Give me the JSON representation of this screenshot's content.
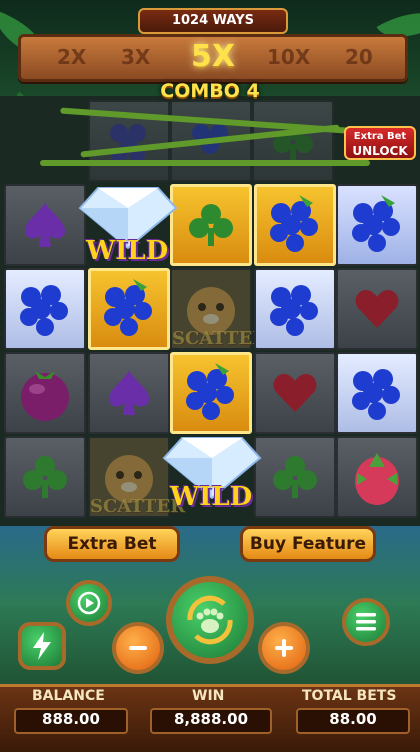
{
  "header": {
    "ways": "1024 WAYS",
    "multipliers": [
      "2X",
      "3X",
      "5X",
      "10X",
      "20"
    ],
    "active_multiplier_index": 2,
    "combo": "COMBO 4",
    "extra_bet_unlock": {
      "line1": "Extra Bet",
      "line2": "UNLOCK"
    }
  },
  "reels": {
    "grid": [
      [
        "spade",
        "club",
        "grape",
        "grape",
        "heart"
      ],
      [
        "grape",
        "grape",
        "scatter",
        "grape",
        "heart"
      ],
      [
        "mangosteen",
        "spade",
        "grape",
        "heart",
        "grape"
      ],
      [
        "club",
        "scatter",
        "grape",
        "club",
        "dragonfruit"
      ]
    ],
    "top_row": [
      "grape",
      "grape",
      "club"
    ],
    "wild_label": "WILD",
    "scatter_label": "SCATTER"
  },
  "buttons": {
    "extra_bet": "Extra Bet",
    "buy_feature": "Buy Feature"
  },
  "controls": {
    "autoplay_icon": "autoplay-icon",
    "turbo_icon": "lightning-icon",
    "spin_icon": "paw-spin-icon",
    "minus_icon": "minus-icon",
    "plus_icon": "plus-icon",
    "menu_icon": "menu-icon"
  },
  "info": {
    "balance_label": "BALANCE",
    "balance": "888.00",
    "win_label": "WIN",
    "win": "8,888.00",
    "total_bets_label": "TOTAL BETS",
    "total_bets": "88.00"
  }
}
